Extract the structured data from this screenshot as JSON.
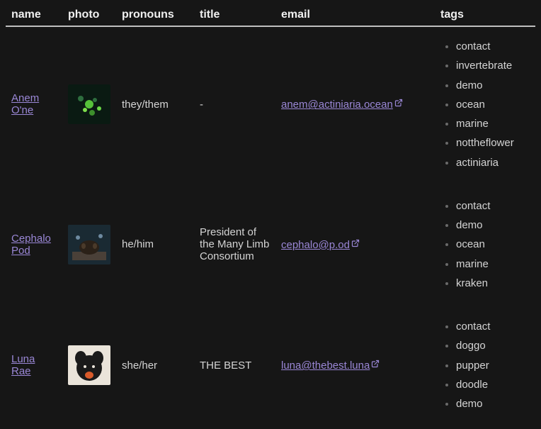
{
  "headers": {
    "name": "name",
    "photo": "photo",
    "pronouns": "pronouns",
    "title": "title",
    "email": "email",
    "tags": "tags"
  },
  "rows": [
    {
      "name": "Anem O'ne",
      "pronouns": "they/them",
      "title": "-",
      "email": "anem@actiniaria.ocean",
      "tags": [
        "contact",
        "invertebrate",
        "demo",
        "ocean",
        "marine",
        "nottheflower",
        "actiniaria"
      ]
    },
    {
      "name": "Cephalo Pod",
      "pronouns": "he/him",
      "title": "President of the Many Limb Consortium",
      "email": "cephalo@p.od",
      "tags": [
        "contact",
        "demo",
        "ocean",
        "marine",
        "kraken"
      ]
    },
    {
      "name": "Luna Rae",
      "pronouns": "she/her",
      "title": "THE BEST",
      "email": "luna@thebest.luna",
      "tags": [
        "contact",
        "doggo",
        "pupper",
        "doodle",
        "demo"
      ]
    }
  ]
}
